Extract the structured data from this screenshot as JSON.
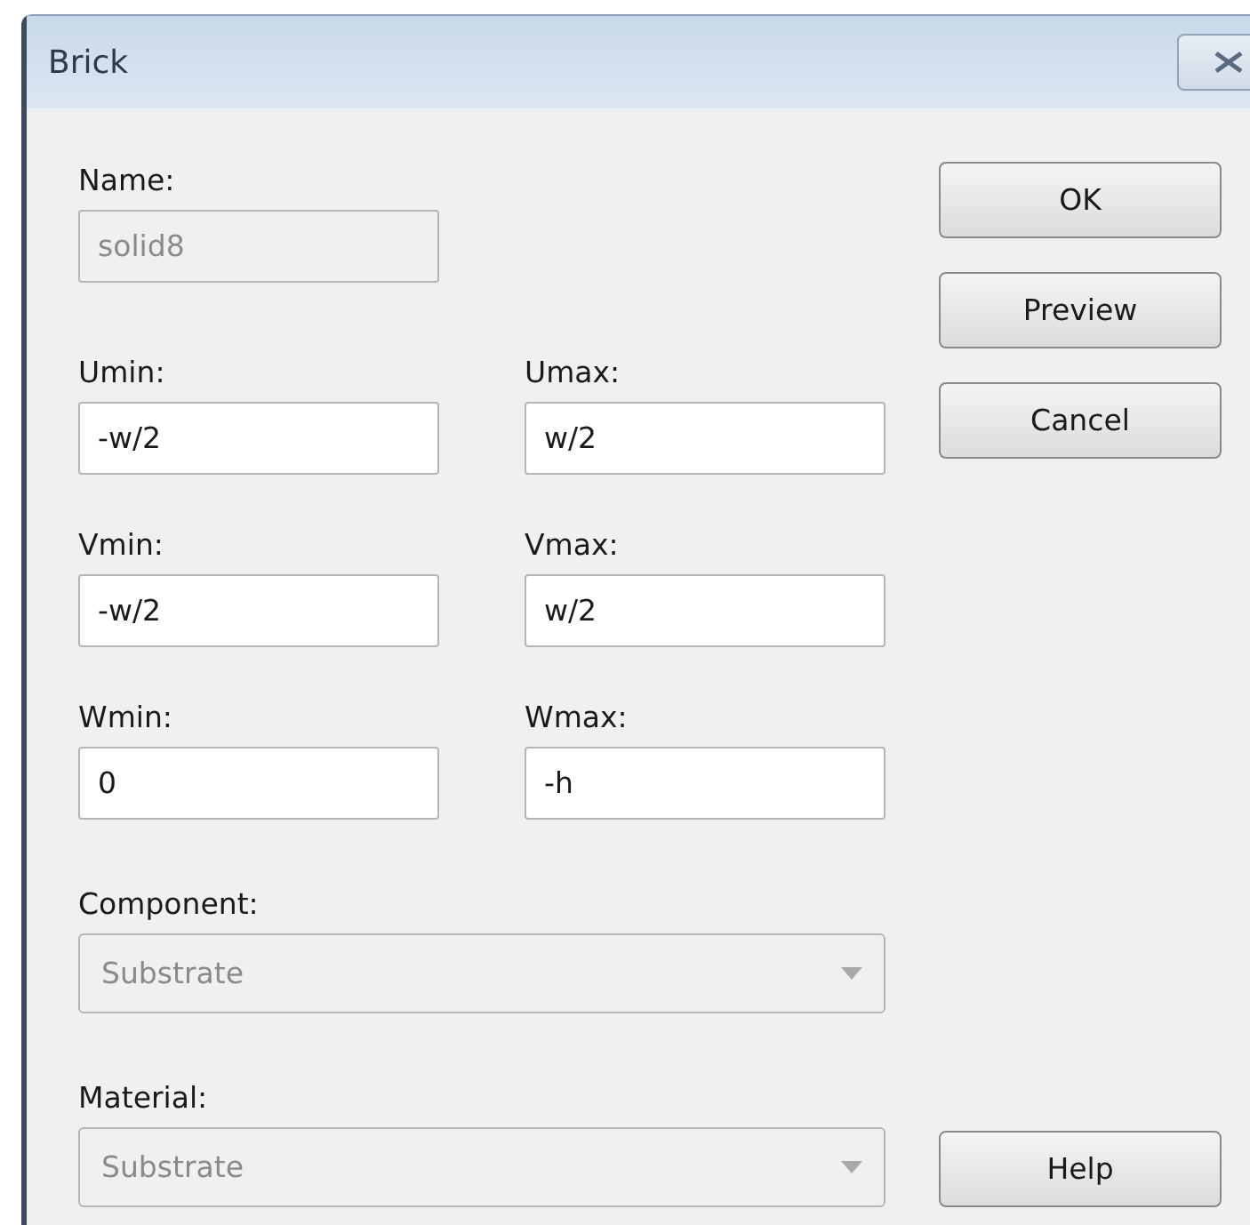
{
  "window": {
    "title": "Brick"
  },
  "name_field": {
    "label": "Name:",
    "value": "solid8",
    "disabled": true
  },
  "fields": [
    {
      "label": "Umin:",
      "value": "-w/2",
      "disabled": false
    },
    {
      "label": "Umax:",
      "value": "w/2",
      "disabled": false
    },
    {
      "label": "Vmin:",
      "value": "-w/2",
      "disabled": false
    },
    {
      "label": "Vmax:",
      "value": "w/2",
      "disabled": false
    },
    {
      "label": "Wmin:",
      "value": "0",
      "disabled": false
    },
    {
      "label": "Wmax:",
      "value": "-h",
      "disabled": false
    }
  ],
  "dropdowns": [
    {
      "label": "Component:",
      "value": "Substrate",
      "disabled": true
    },
    {
      "label": "Material:",
      "value": "Substrate",
      "disabled": true
    }
  ],
  "buttons": [
    {
      "label": "OK"
    },
    {
      "label": "Preview"
    },
    {
      "label": "Cancel"
    }
  ],
  "help_button": {
    "label": "Help"
  }
}
